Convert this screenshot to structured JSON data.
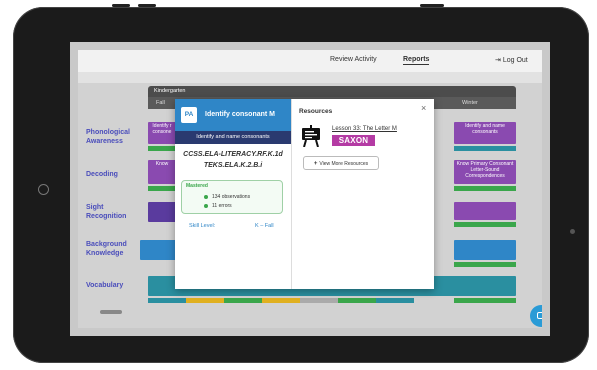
{
  "nav": {
    "review_activity": "Review Activity",
    "reports": "Reports",
    "logout": "Log Out"
  },
  "grade_header": "Kindergarten",
  "seasons": [
    "Fall",
    "Winter"
  ],
  "rows": [
    {
      "label": "Phonological Awareness"
    },
    {
      "label": "Decoding"
    },
    {
      "label": "Sight Recognition"
    },
    {
      "label": "Background Knowledge"
    },
    {
      "label": "Vocabulary"
    }
  ],
  "grid_cells": {
    "phon_left": "Identify r consone",
    "phon_right": "Identify and name consonants",
    "decoding_left": "Know",
    "decoding_right": "Know Primary Consonant Letter-Sound Correspondences"
  },
  "modal": {
    "badge": "PA",
    "title": "Identify consonant M",
    "subtitle": "Identify and name consonants",
    "standards": [
      "CCSS.ELA-LITERACY.RF.K.1d",
      "TEKS.ELA.K.2.B.i"
    ],
    "mastered_label": "Mastered",
    "observations": "134 observations",
    "errors": "11 errors",
    "skill_level_label": "Skill Level:",
    "skill_level_value": "K – Fall",
    "resources_title": "Resources",
    "close": "×",
    "lesson_link": "Lesson 33: The Letter M",
    "publisher": "SAXON",
    "view_more": "View More Resources"
  },
  "colors": {
    "accent_blue": "#2f86c7",
    "navy": "#2a3a70",
    "purple": "#8a4ab0",
    "green": "#3aa64b",
    "teal": "#2a8fa0",
    "saxon": "#b43ba4"
  }
}
